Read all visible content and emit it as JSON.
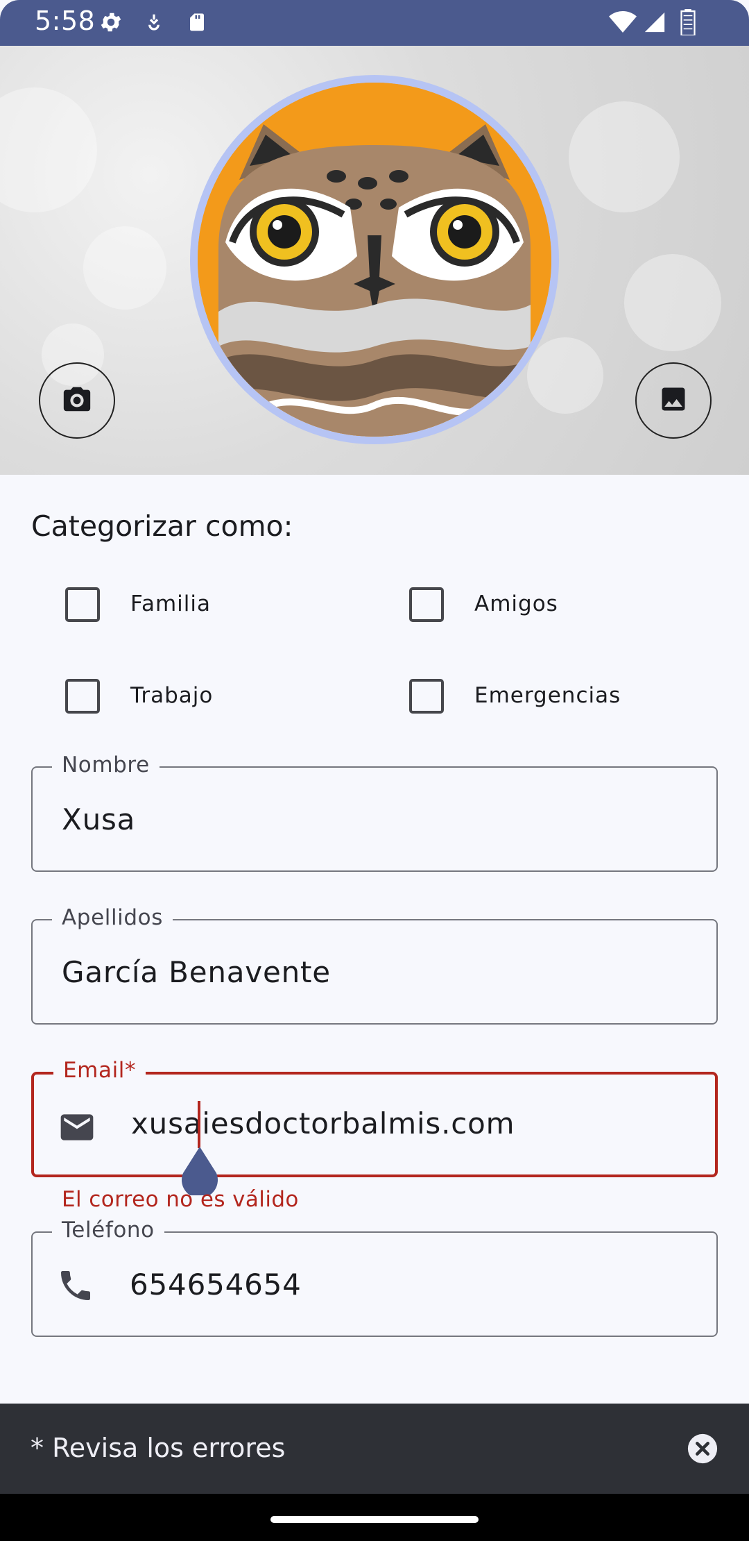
{
  "status_bar": {
    "time": "5:58",
    "icons": [
      "settings-icon",
      "usb-debug-icon",
      "sd-card-icon",
      "wifi-icon",
      "signal-icon",
      "battery-icon"
    ]
  },
  "header": {
    "avatar_description": "owl-avatar",
    "camera_button": "camera-icon",
    "gallery_button": "image-icon"
  },
  "categories": {
    "title": "Categorizar como:",
    "items": [
      {
        "label": "Familia",
        "checked": false
      },
      {
        "label": "Amigos",
        "checked": false
      },
      {
        "label": "Trabajo",
        "checked": false
      },
      {
        "label": "Emergencias",
        "checked": false
      }
    ]
  },
  "form": {
    "nombre": {
      "label": "Nombre",
      "value": "Xusa"
    },
    "apellidos": {
      "label": "Apellidos",
      "value": "García Benavente"
    },
    "email": {
      "label": "Email*",
      "value": "xusaiesdoctorbalmis.com",
      "error": "El correo no es válido",
      "icon": "email-icon"
    },
    "telefono": {
      "label": "Teléfono",
      "value": "654654654",
      "icon": "phone-icon"
    }
  },
  "snackbar": {
    "message": "* Revisa los errores",
    "close_icon": "close-circle-icon"
  },
  "colors": {
    "status_bar": "#4b5a8e",
    "error": "#b3261e",
    "avatar_ring": "#b6c4f4",
    "avatar_bg": "#f39a1a",
    "snackbar": "#2e3036"
  }
}
